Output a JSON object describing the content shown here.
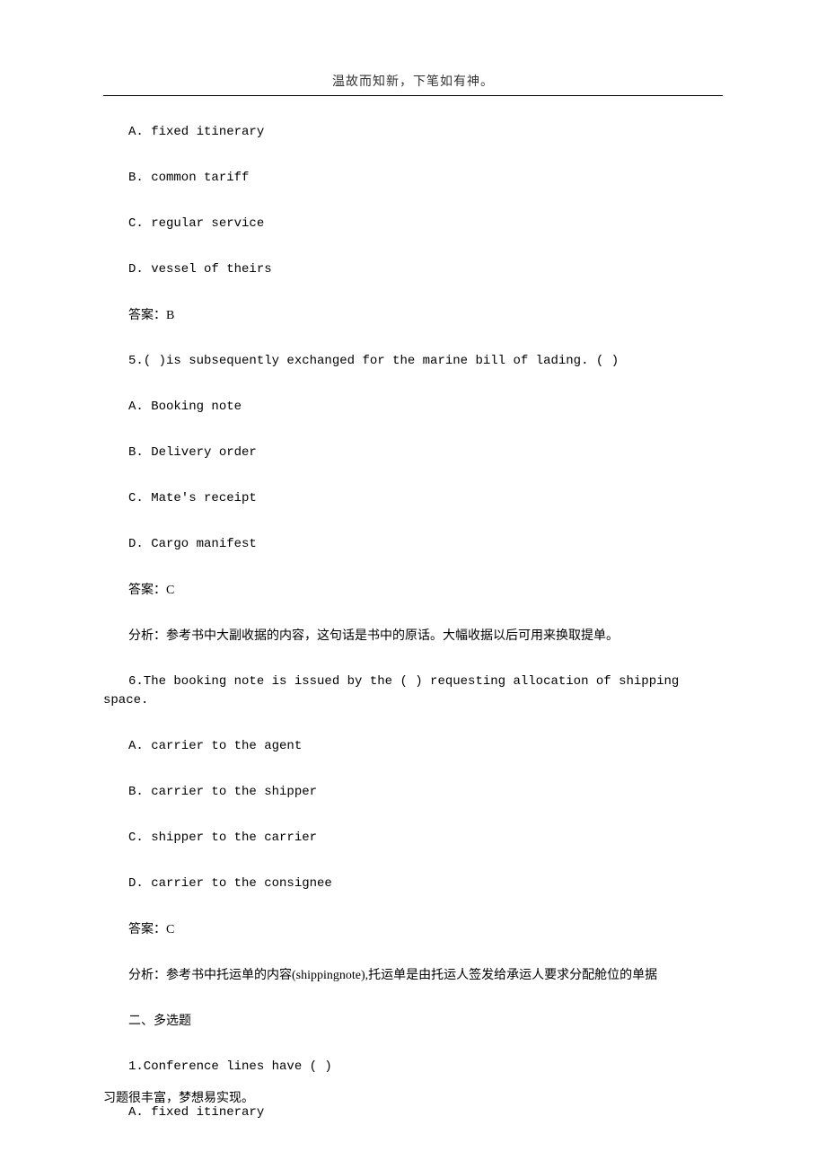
{
  "header": {
    "title": "温故而知新，下笔如有神。"
  },
  "lines": [
    {
      "cls": "para",
      "text": "A. fixed itinerary"
    },
    {
      "cls": "para",
      "text": "B. common tariff"
    },
    {
      "cls": "para",
      "text": "C. regular service"
    },
    {
      "cls": "para",
      "text": "D. vessel of theirs"
    },
    {
      "cls": "para-cn",
      "text": "答案：B"
    },
    {
      "cls": "para",
      "text": "5.(  )is subsequently exchanged for the marine bill of lading. (  )"
    },
    {
      "cls": "para",
      "text": "A. Booking note"
    },
    {
      "cls": "para",
      "text": "B. Delivery order"
    },
    {
      "cls": "para",
      "text": "C. Mate's receipt"
    },
    {
      "cls": "para",
      "text": "D. Cargo manifest"
    },
    {
      "cls": "para-cn",
      "text": "答案：C"
    },
    {
      "cls": "para-cn",
      "text": "分析：参考书中大副收据的内容，这句话是书中的原话。大幅收据以后可用来换取提单。"
    },
    {
      "cls": "para",
      "text": "6.The booking note is issued by the (  ) requesting allocation of shipping space."
    },
    {
      "cls": "para",
      "text": "A. carrier to the agent"
    },
    {
      "cls": "para",
      "text": "B. carrier to the shipper"
    },
    {
      "cls": "para",
      "text": "C. shipper to the carrier"
    },
    {
      "cls": "para",
      "text": "D. carrier to the consignee"
    },
    {
      "cls": "para-cn",
      "text": "答案：C"
    },
    {
      "cls": "para-cn",
      "text": "分析：参考书中托运单的内容(shippingnote),托运单是由托运人签发给承运人要求分配舱位的单据"
    },
    {
      "cls": "para-cn",
      "text": "二、多选题"
    },
    {
      "cls": "para",
      "text": "1.Conference lines have (  )"
    },
    {
      "cls": "para",
      "text": "A. fixed itinerary"
    }
  ],
  "footer": {
    "text": "习题很丰富，梦想易实现。"
  }
}
